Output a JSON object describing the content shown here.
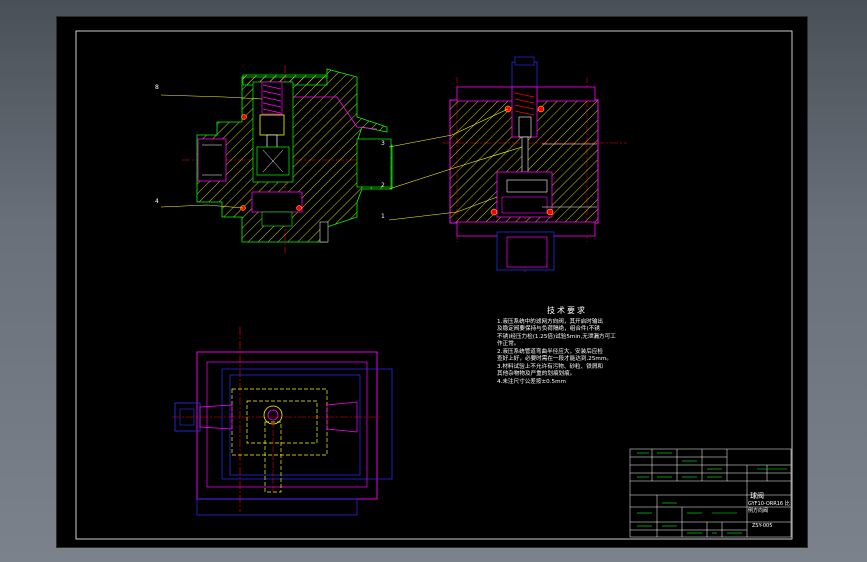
{
  "colors": {
    "background": "#000000",
    "outline_green": "#00ff00",
    "hatch_yellow": "#ffff00",
    "body_magenta": "#ff00ff",
    "center_red": "#ff0000",
    "hidden_blue": "#3030ff",
    "white": "#ffffff"
  },
  "leaders": {
    "l1": "8",
    "l2": "4",
    "l3": "3",
    "l4": "2",
    "l5": "1"
  },
  "notes": {
    "title": "技术要求",
    "lines": [
      "1.液压系统中的滤网方向阀，其开启时输出",
      "及稳定阀要保持与负荷隔绝，组合件(不锈",
      "不锈)经压力检(1.25倍)试验5min,无泄漏方可工",
      "作正常。",
      "2.液压系统管道弯曲半径应大，安装后应检",
      "查好上好，必要时需在一段才能达到.25mm。",
      "3.材料试验上不允许有污物、砂粒、铁屑和",
      "其他杂物物及严重的划痕划痕。",
      "4.未注尺寸公差按±0.5mm"
    ]
  },
  "title_block": {
    "name_line1": "球阀",
    "name_line2": "GYF10-ORR16 比例方向阀",
    "drawing_no": "ZSY-005"
  }
}
